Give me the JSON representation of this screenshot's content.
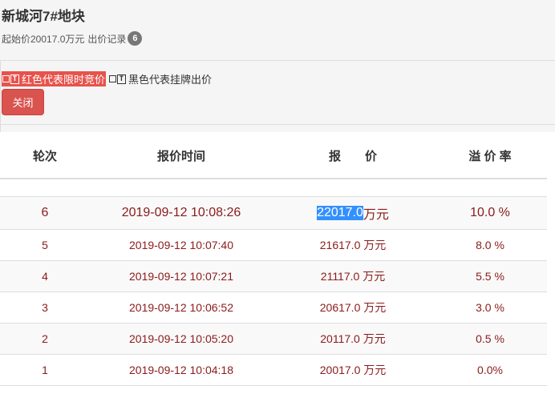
{
  "header": {
    "title": "新城河7#地块",
    "start_price": "起始价20017.0万元",
    "bid_record_label": "出价记录",
    "bid_count": "6"
  },
  "legend": {
    "red_label": "红色代表限时竞价",
    "black_label": "黑色代表挂牌出价",
    "icon_letter": "T",
    "red_color": "#e7534c"
  },
  "actions": {
    "close_label": "关闭",
    "close_color": "#d9534f"
  },
  "table": {
    "columns": [
      "轮次",
      "报价时间",
      "报　　价",
      "溢 价 率"
    ],
    "rows": [
      {
        "round": "6",
        "time": "2019-09-12 10:08:26",
        "price": "22017.0",
        "unit": "万元",
        "premium": "10.0 %"
      },
      {
        "round": "5",
        "time": "2019-09-12 10:07:40",
        "price": "21617.0",
        "unit": "万元",
        "premium": "8.0 %"
      },
      {
        "round": "4",
        "time": "2019-09-12 10:07:21",
        "price": "21117.0",
        "unit": "万元",
        "premium": "5.5 %"
      },
      {
        "round": "3",
        "time": "2019-09-12 10:06:52",
        "price": "20617.0",
        "unit": "万元",
        "premium": "3.0 %"
      },
      {
        "round": "2",
        "time": "2019-09-12 10:05:20",
        "price": "20117.0",
        "unit": "万元",
        "premium": "0.5 %"
      },
      {
        "round": "1",
        "time": "2019-09-12 10:04:18",
        "price": "20017.0",
        "unit": "万元",
        "premium": "0.0%"
      }
    ],
    "row_text_color": "#8b1a1a"
  }
}
